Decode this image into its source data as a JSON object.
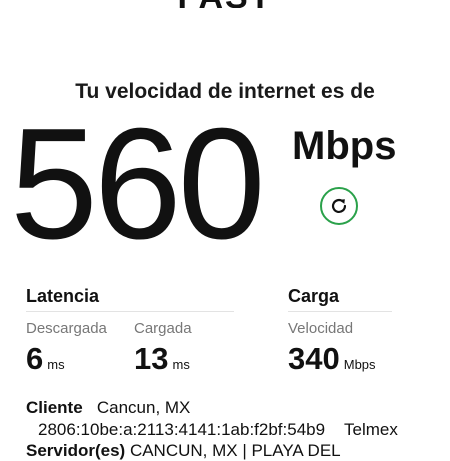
{
  "header": {
    "logo": "FAST"
  },
  "result": {
    "headline": "Tu velocidad de internet es de",
    "speed": "560",
    "unit": "Mbps"
  },
  "latency": {
    "title": "Latencia",
    "download_label": "Descargada",
    "download_value": "6",
    "download_unit": "ms",
    "upload_label": "Cargada",
    "upload_value": "13",
    "upload_unit": "ms"
  },
  "upload": {
    "title": "Carga",
    "speed_label": "Velocidad",
    "speed_value": "340",
    "speed_unit": "Mbps"
  },
  "connection": {
    "client_label": "Cliente",
    "client_location": "Cancun, MX",
    "client_ip": "2806:10be:a:2113:4141:1ab:f2bf:54b9",
    "client_isp": "Telmex",
    "servers_label": "Servidor(es)",
    "servers_value": "CANCUN, MX | PLAYA DEL"
  },
  "colors": {
    "accent": "#2aa14a"
  },
  "icons": {
    "refresh": "refresh-icon"
  }
}
